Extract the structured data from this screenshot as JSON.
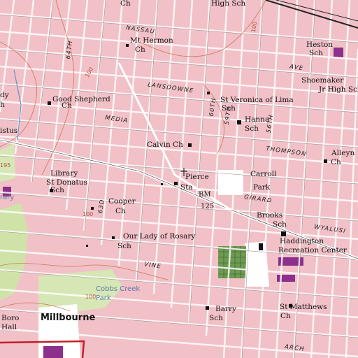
{
  "labels": [
    "Ch",
    "High Sch",
    "Mt Hermon",
    "Ch",
    "Heston",
    "Sch",
    "Shoemaker",
    "Jr High Sch",
    "dy",
    "Good Shepherd",
    "h",
    "Ch",
    "St Veronica of Lima",
    "Sch",
    "Hanna",
    "Sch",
    "istus",
    "Calvin Ch",
    "Alleyn",
    "Ch",
    "Library",
    "Carroll",
    "Park",
    "St Donatus",
    "Sch",
    "Pierce",
    "Sta",
    "Cooper",
    "Ch",
    "Brooks",
    "Sch",
    "Our Lady of Rosary",
    "Sch",
    "Haddington",
    "Recreation Center",
    "St Matthews",
    "Ch",
    "Barry",
    "Sch",
    "Boro",
    "Hall"
  ],
  "town": "Millbourne",
  "parks": [
    "Cobbs Creek",
    "Park",
    "rary"
  ],
  "streets": [
    "NASSAU",
    "LANSDOWNE",
    "MEDIA",
    "THOMPSON",
    "GIRARD",
    "WYALUSI",
    "VINE",
    "ARCH",
    "AVE",
    "64TH",
    "60TH",
    "59TH",
    "56TH",
    "63D"
  ],
  "contours": [
    "100",
    "195",
    "100",
    "100",
    "100"
  ],
  "benchmark": {
    "label": "BM",
    "value": "125"
  }
}
